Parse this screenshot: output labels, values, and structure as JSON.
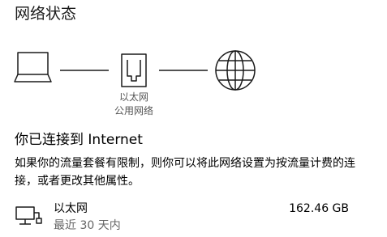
{
  "page": {
    "title": "网络状态"
  },
  "diagram": {
    "device_icon": "laptop-icon",
    "adapter_icon": "ethernet-icon",
    "internet_icon": "globe-icon",
    "adapter_name": "以太网",
    "adapter_profile": "公用网络"
  },
  "status": {
    "title": "你已连接到 Internet",
    "description": "如果你的流量套餐有限制，则你可以将此网络设置为按流量计费的连接，或者更改其他属性。"
  },
  "connection": {
    "icon": "ethernet-pc-icon",
    "name": "以太网",
    "period": "最近 30 天内",
    "usage": "162.46 GB"
  },
  "colors": {
    "text": "#000000",
    "secondary_text": "#666666",
    "icon_stroke": "#1a1a1a"
  }
}
